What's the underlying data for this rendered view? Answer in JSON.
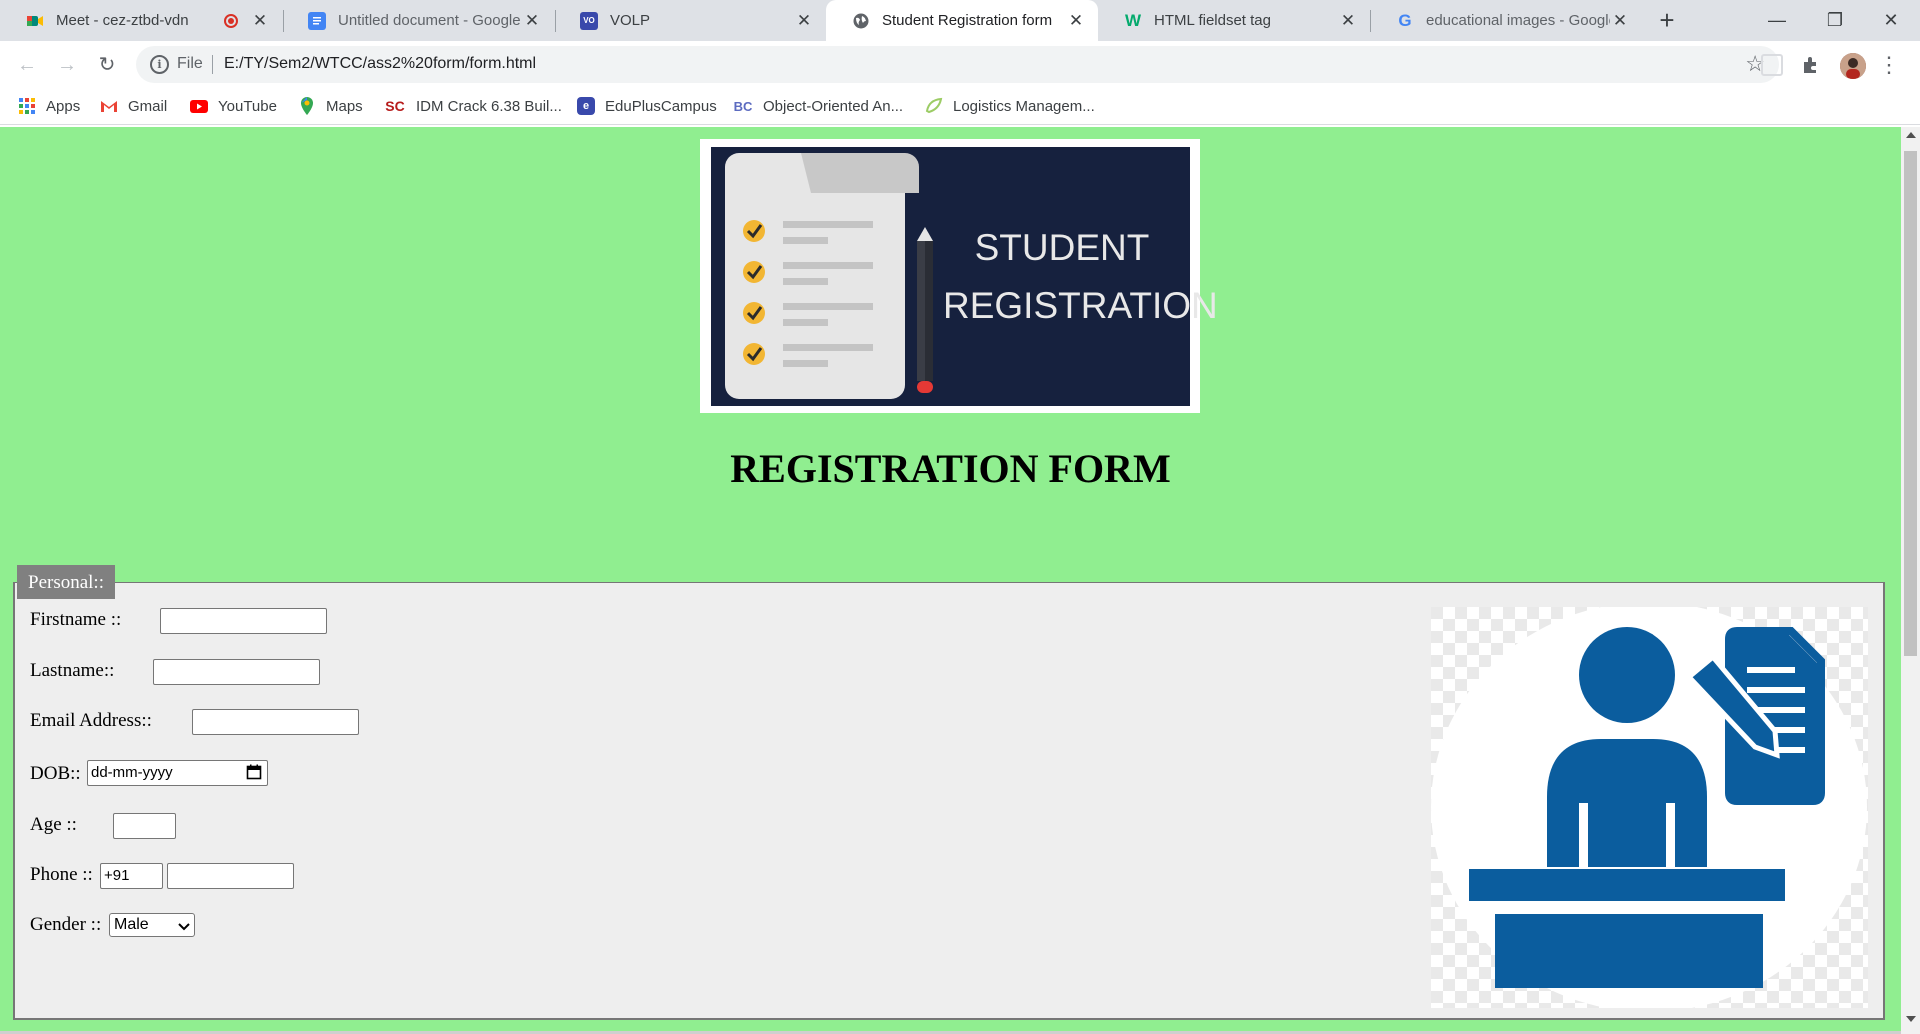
{
  "browser": {
    "tabs": [
      {
        "title": "Meet - cez-ztbd-vdn",
        "icon": "google-meet-icon",
        "color": "#00897b"
      },
      {
        "title": "Untitled document - Google",
        "icon": "google-docs-icon",
        "color": "#4285f4"
      },
      {
        "title": "VOLP",
        "icon": "volp-icon",
        "color": "#3949ab"
      },
      {
        "title": "Student Registration form",
        "icon": "globe-icon",
        "color": "#5f6368"
      },
      {
        "title": "HTML fieldset tag",
        "icon": "w3schools-icon",
        "color": "#04aa6d"
      },
      {
        "title": "educational images - Google",
        "icon": "google-icon",
        "color": "#4285f4"
      }
    ],
    "active_tab": 3,
    "address": {
      "scheme_label": "File",
      "url": "E:/TY/Sem2/WTCC/ass2%20form/form.html"
    },
    "bookmarks": [
      {
        "label": "Apps",
        "icon": "apps-grid-icon"
      },
      {
        "label": "Gmail",
        "icon": "gmail-icon"
      },
      {
        "label": "YouTube",
        "icon": "youtube-icon"
      },
      {
        "label": "Maps",
        "icon": "maps-icon"
      },
      {
        "label": "IDM Crack 6.38 Buil...",
        "icon": "sc-icon"
      },
      {
        "label": "EduPlusCampus",
        "icon": "eduplus-icon"
      },
      {
        "label": "Object-Oriented An...",
        "icon": "bc-icon"
      },
      {
        "label": "Logistics Managem...",
        "icon": "leaf-icon"
      }
    ]
  },
  "page": {
    "banner": {
      "line1": "STUDENT",
      "line2": "REGISTRATION"
    },
    "heading": "REGISTRATION FORM",
    "background": "#90ee90",
    "fieldset": {
      "legend": "Personal::",
      "fields": {
        "firstname": {
          "label": "Firstname ::",
          "value": ""
        },
        "lastname": {
          "label": "Lastname::",
          "value": ""
        },
        "email": {
          "label": "Email Address::",
          "value": ""
        },
        "dob": {
          "label": "DOB::",
          "placeholder": "dd-mm-yyyy"
        },
        "age": {
          "label": "Age ::",
          "value": ""
        },
        "phone": {
          "label": "Phone ::",
          "country_code": "+91",
          "value": ""
        },
        "gender": {
          "label": "Gender ::",
          "selected": "Male"
        }
      }
    }
  }
}
